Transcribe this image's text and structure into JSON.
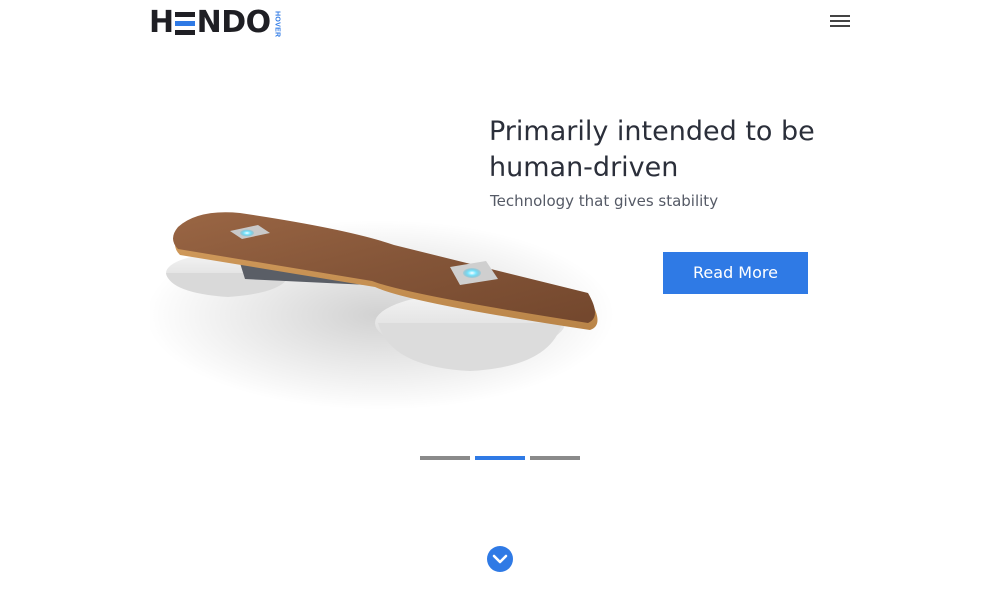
{
  "header": {
    "logo": {
      "text_letters": [
        "H",
        "N",
        "D",
        "O"
      ],
      "subtext": "HOVER",
      "accent_color": "#2f7ae5"
    },
    "menu_icon": "hamburger-menu-icon"
  },
  "hero": {
    "title": "Primarily intended to be human-driven",
    "subtitle": "Technology that gives stability",
    "read_more_label": "Read More",
    "image": "hoverboard-product-image"
  },
  "slider": {
    "slide_count": 3,
    "active_index": 1
  },
  "scroll_down_icon": "chevron-down-circle-icon",
  "colors": {
    "accent": "#2f7ae5",
    "title": "#2b2f3a",
    "inactive_dot": "#8a8a8a"
  }
}
